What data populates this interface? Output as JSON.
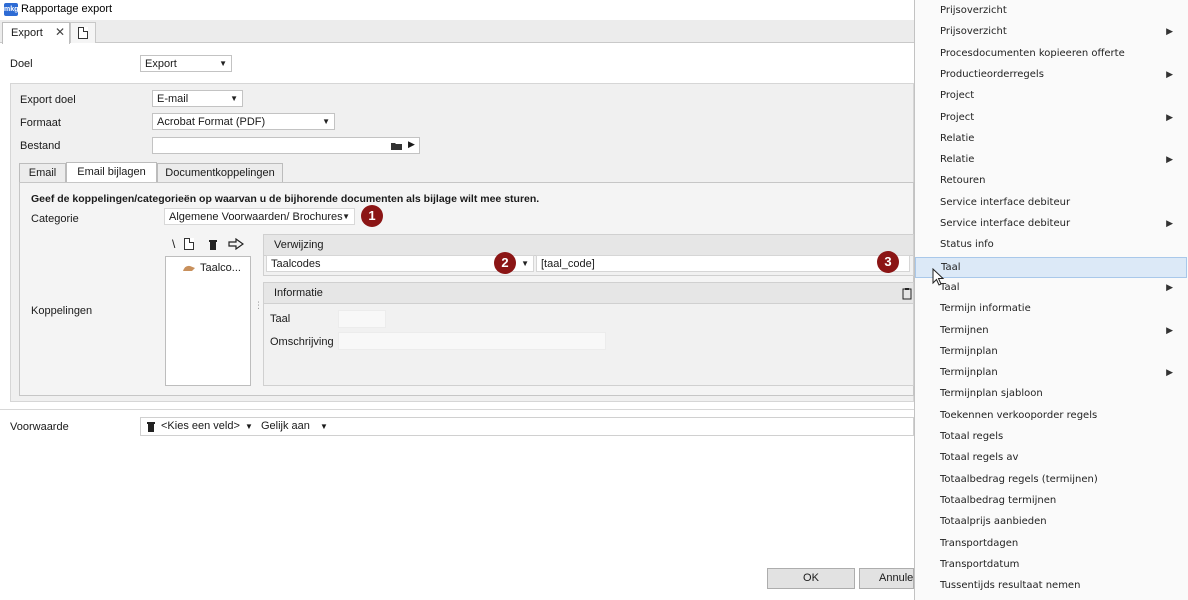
{
  "window": {
    "title": "Rapportage export",
    "logo_text": "mkg"
  },
  "tabs": [
    {
      "label": "Export",
      "close": "✕"
    }
  ],
  "doel": {
    "label": "Doel",
    "value": "Export"
  },
  "export_doel": {
    "label": "Export doel",
    "value": "E-mail"
  },
  "formaat": {
    "label": "Formaat",
    "value": "Acrobat Format (PDF)"
  },
  "bestand": {
    "label": "Bestand",
    "value": ""
  },
  "inner_tabs": [
    {
      "label": "Email",
      "active": false
    },
    {
      "label": "Email bijlagen",
      "active": true
    },
    {
      "label": "Documentkoppelingen",
      "active": false
    }
  ],
  "instruction": "Geef de koppelingen/categorieën op waarvan u de bijhorende documenten als bijlage wilt mee sturen.",
  "categorie": {
    "label": "Categorie",
    "value": "Algemene Voorwaarden/ Brochures"
  },
  "koppelingen": {
    "label": "Koppelingen",
    "toolbar_backslash": "\\",
    "list_item": "Taalco..."
  },
  "verwijzing": {
    "title": "Verwijzing",
    "select_value": "Taalcodes",
    "field_value": "[taal_code]"
  },
  "informatie": {
    "title": "Informatie",
    "fields": [
      {
        "label": "Taal",
        "value": ""
      },
      {
        "label": "Omschrijving",
        "value": ""
      }
    ]
  },
  "badges": {
    "one": "1",
    "two": "2",
    "three": "3",
    "color": "#8b1515"
  },
  "voorwaarde": {
    "label": "Voorwaarde",
    "field": "<Kies een veld>",
    "operator": "Gelijk aan"
  },
  "buttons": {
    "ok": "OK",
    "cancel": "Annule"
  },
  "context_menu": {
    "items": [
      {
        "label": "Prijsoverzicht",
        "submenu": false
      },
      {
        "label": "Prijsoverzicht",
        "submenu": true
      },
      {
        "label": "Procesdocumenten kopieeren offerte",
        "submenu": false
      },
      {
        "label": "Productieorderregels",
        "submenu": true
      },
      {
        "label": "Project",
        "submenu": false
      },
      {
        "label": "Project",
        "submenu": true
      },
      {
        "label": "Relatie",
        "submenu": false
      },
      {
        "label": "Relatie",
        "submenu": true
      },
      {
        "label": "Retouren",
        "submenu": false
      },
      {
        "label": "Service interface debiteur",
        "submenu": false
      },
      {
        "label": "Service interface debiteur",
        "submenu": true
      },
      {
        "label": "Status info",
        "submenu": false
      },
      {
        "label": "Taal",
        "submenu": false,
        "highlighted": true
      },
      {
        "label": "Taal",
        "submenu": true
      },
      {
        "label": "Termijn informatie",
        "submenu": false
      },
      {
        "label": "Termijnen",
        "submenu": true
      },
      {
        "label": "Termijnplan",
        "submenu": false
      },
      {
        "label": "Termijnplan",
        "submenu": true
      },
      {
        "label": "Termijnplan sjabloon",
        "submenu": false
      },
      {
        "label": "Toekennen verkooporder regels",
        "submenu": false
      },
      {
        "label": "Totaal regels",
        "submenu": false
      },
      {
        "label": "Totaal regels av",
        "submenu": false
      },
      {
        "label": "Totaalbedrag regels (termijnen)",
        "submenu": false
      },
      {
        "label": "Totaalbedrag termijnen",
        "submenu": false
      },
      {
        "label": "Totaalprijs aanbieden",
        "submenu": false
      },
      {
        "label": "Transportdagen",
        "submenu": false
      },
      {
        "label": "Transportdatum",
        "submenu": false
      },
      {
        "label": "Tussentijds resultaat nemen",
        "submenu": false
      }
    ]
  }
}
